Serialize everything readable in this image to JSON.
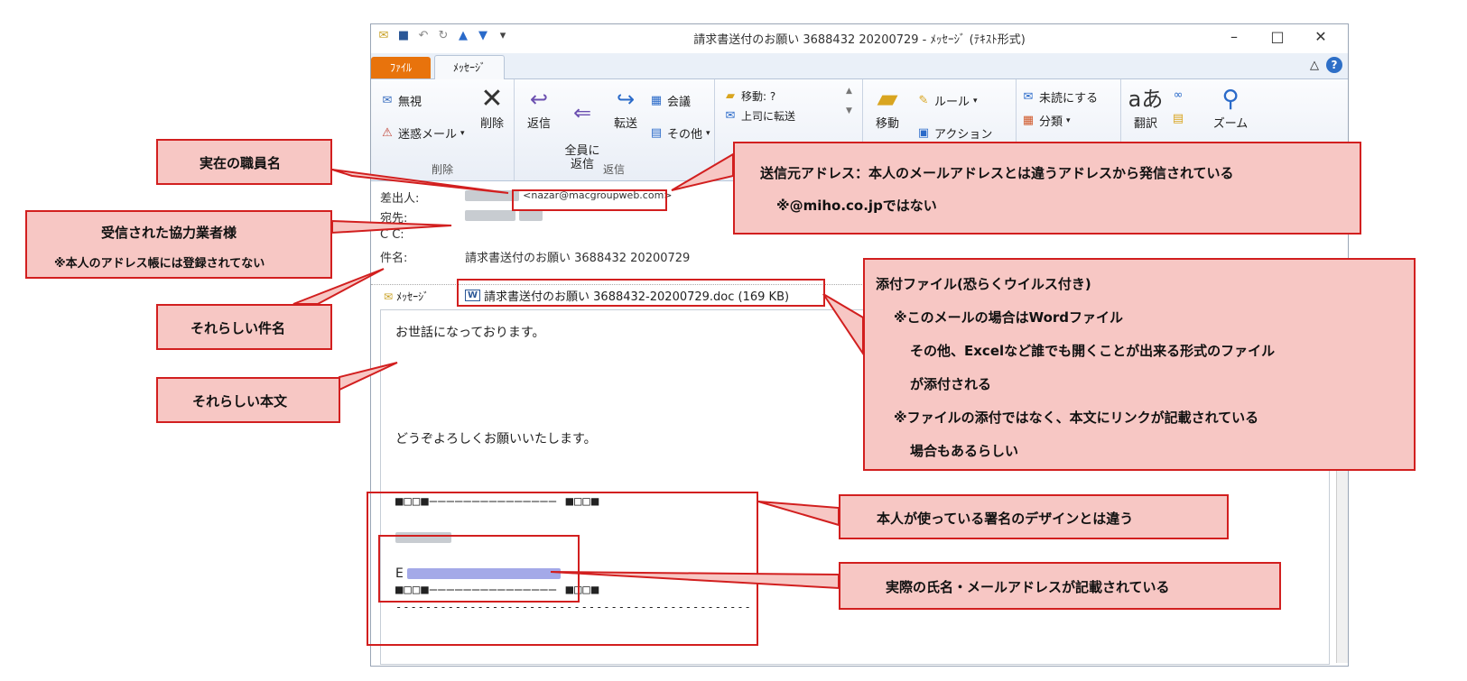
{
  "window": {
    "title": "請求書送付のお願い 3688432 20200729 - ﾒｯｾｰｼﾞ (ﾃｷｽﾄ形式)",
    "controls": {
      "minimize": "–",
      "maximize": "□",
      "close": "✕"
    }
  },
  "tabs": {
    "file": "ﾌｧｲﾙ",
    "message": "ﾒｯｾｰｼﾞ"
  },
  "ribbon": {
    "ignore": "無視",
    "junk": "迷惑メール",
    "delete": "削除",
    "delete_group": "削除",
    "reply": "返信",
    "reply_all": "全員に\n返信",
    "forward": "転送",
    "meeting": "会議",
    "other": "その他",
    "respond_group": "返信",
    "move_to": "移動: ?",
    "to_manager": "上司に転送",
    "move": "移動",
    "rules": "ルール",
    "actions": "アクション",
    "mark_unread": "未読にする",
    "categorize": "分類",
    "translate": "翻訳",
    "zoom": "ズーム"
  },
  "header_fields": {
    "from_label": "差出人:",
    "from_email": "<nazar@macgroupweb.com>",
    "to_label": "宛先:",
    "cc_label": "C C:",
    "subject_label": "件名:",
    "subject": "請求書送付のお願い 3688432 20200729"
  },
  "attachment": {
    "message_tab": "ﾒｯｾｰｼﾞ",
    "file": "請求書送付のお願い 3688432-20200729.doc (169 KB)"
  },
  "body": {
    "greeting": "お世話になっております。",
    "closing": "どうぞよろしくお願いいたします。",
    "sig_border_top": "■□□■――――――――――――――― ■□□■",
    "sig_email_prefix": "E",
    "sig_border_bottom": "■□□■――――――――――――――― ■□□■",
    "dashes": "------------------------------------------------"
  },
  "annotations": {
    "real_staff": "実在の職員名",
    "recipient_line1": "受信された協力業者様",
    "recipient_line2": "※本人のアドレス帳には登録されてない",
    "subject_like": "それらしい件名",
    "body_like": "それらしい本文",
    "sender_line1": "送信元アドレス：本人のメールアドレスとは違うアドレスから発信されている",
    "sender_line2": "※@miho.co.jpではない",
    "attach_line1": "添付ファイル(恐らくウイルス付き)",
    "attach_line2": "※このメールの場合はWordファイル",
    "attach_line3": "その他、Excelなど誰でも開くことが出来る形式のファイル",
    "attach_line4": "が添付される",
    "attach_line5": "※ファイルの添付ではなく、本文にリンクが記載されている",
    "attach_line6": "場合もあるらしい",
    "signature_diff": "本人が使っている署名のデザインとは違う",
    "real_name_email": "実際の氏名・メールアドレスが記載されている"
  },
  "colors": {
    "callout_fill": "#f7c7c4",
    "callout_border": "#d21f1f",
    "file_tab": "#e8730c"
  }
}
